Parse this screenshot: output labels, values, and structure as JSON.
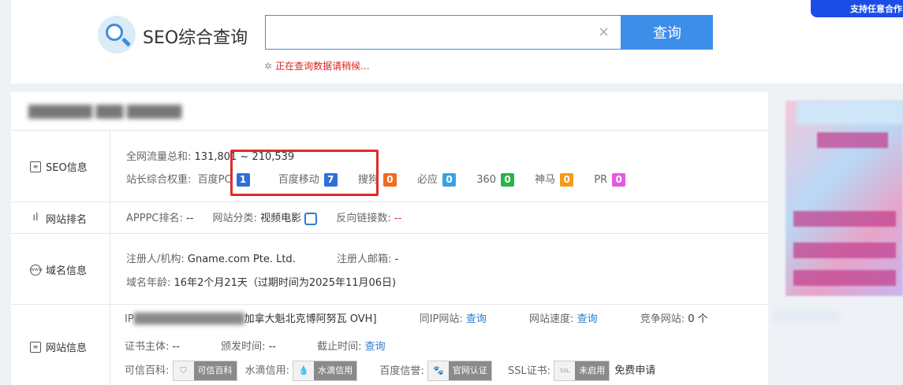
{
  "header": {
    "logo_text": "SEO综合查询",
    "search_value": "                ",
    "search_button": "查询",
    "loading_text": "正在查询数据请稍候...",
    "promo_text": "支持任意合作"
  },
  "seo": {
    "section_title": "SEO信息",
    "traffic_label": "全网流量总和:",
    "traffic_value": "131,801 ~ 210,539",
    "weight_label": "站长综合权重:",
    "weights": [
      {
        "label": "百度PC",
        "value": "1",
        "color": "#2f6fd8"
      },
      {
        "label": "百度移动",
        "value": "7",
        "color": "#2f6fd8"
      },
      {
        "label": "搜狗",
        "value": "0",
        "color": "#f06b1e"
      },
      {
        "label": "必应",
        "value": "0",
        "color": "#3aa1e8"
      },
      {
        "label": "360",
        "value": "0",
        "color": "#29b34a"
      },
      {
        "label": "神马",
        "value": "0",
        "color": "#f59b18"
      },
      {
        "label": "PR",
        "value": "0",
        "color": "#e359e0"
      }
    ]
  },
  "ranking": {
    "section_title": "网站排名",
    "appc_label": "APPPC排名:",
    "appc_value": "--",
    "category_label": "网站分类:",
    "category_value": "视频电影",
    "backlinks_label": "反向链接数:",
    "backlinks_value": "--"
  },
  "domain": {
    "section_title": "域名信息",
    "registrar_label": "注册人/机构:",
    "registrar_value": "Gname.com Pte. Ltd.",
    "email_label": "注册人邮箱:",
    "email_value": "-",
    "age_label": "域名年龄:",
    "age_value": "16年2个月21天（过期时间为2025年11月06日)"
  },
  "site": {
    "section_title": "网站信息",
    "ip_label": "IP",
    "ip_location": "加拿大魁北克博阿努瓦 OVH]",
    "same_ip_label": "同IP网站:",
    "same_ip_link": "查询",
    "speed_label": "网站速度:",
    "speed_link": "查询",
    "competitor_label": "竞争网站:",
    "competitor_value": "0 个",
    "cert_owner_label": "证书主体:",
    "cert_owner_value": "--",
    "issue_label": "颁发时间:",
    "issue_value": "--",
    "expire_label": "截止时间:",
    "expire_link": "查询",
    "baike_label": "可信百科:",
    "baike_badge": "可信百科",
    "shuidi_label": "水滴信用:",
    "shuidi_badge": "水滴信用",
    "baidu_label": "百度信誉:",
    "baidu_badge": "官网认证",
    "ssl_label": "SSL证书:",
    "ssl_icon": "SSL",
    "ssl_badge": "未启用",
    "free_apply": "免费申请"
  }
}
